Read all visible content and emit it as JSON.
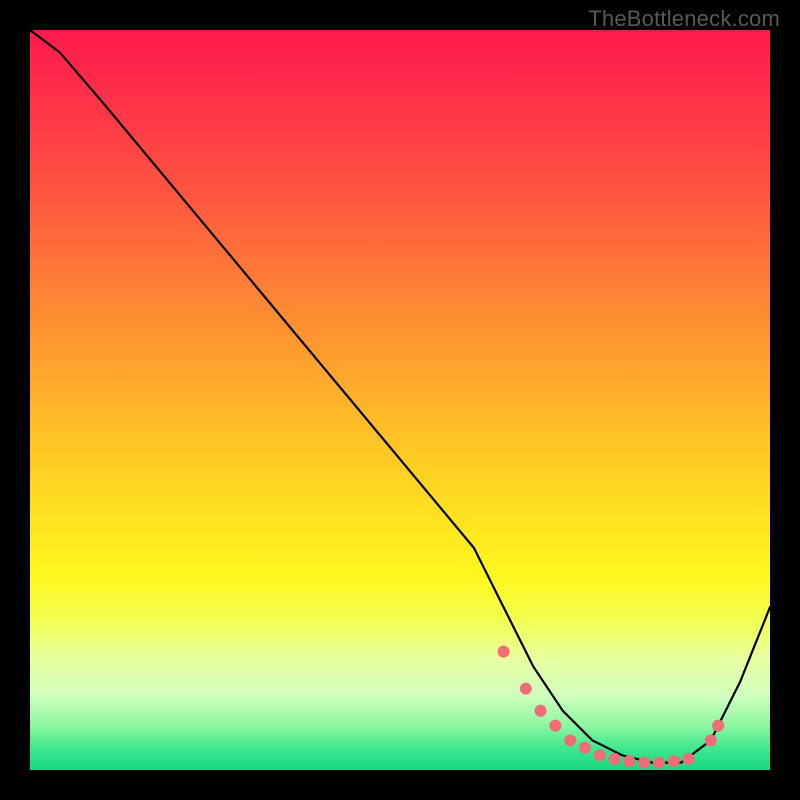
{
  "watermark": "TheBottleneck.com",
  "chart_data": {
    "type": "line",
    "title": "",
    "xlabel": "",
    "ylabel": "",
    "xlim": [
      0,
      100
    ],
    "ylim": [
      0,
      100
    ],
    "series": [
      {
        "name": "curve",
        "x": [
          0,
          4,
          10,
          20,
          30,
          40,
          50,
          60,
          64,
          68,
          72,
          76,
          80,
          84,
          88,
          92,
          96,
          100
        ],
        "values": [
          100,
          97,
          90,
          78,
          66,
          54,
          42,
          30,
          22,
          14,
          8,
          4,
          2,
          1,
          1,
          4,
          12,
          22
        ]
      }
    ],
    "markers": {
      "color": "#f06d78",
      "radius": 6,
      "x": [
        64,
        67,
        69,
        71,
        73,
        75,
        77,
        79,
        81,
        83,
        85,
        87,
        89,
        92,
        93
      ],
      "values": [
        16,
        11,
        8,
        6,
        4,
        3,
        2,
        1.5,
        1.2,
        1,
        1,
        1.2,
        1.5,
        4,
        6
      ]
    }
  }
}
